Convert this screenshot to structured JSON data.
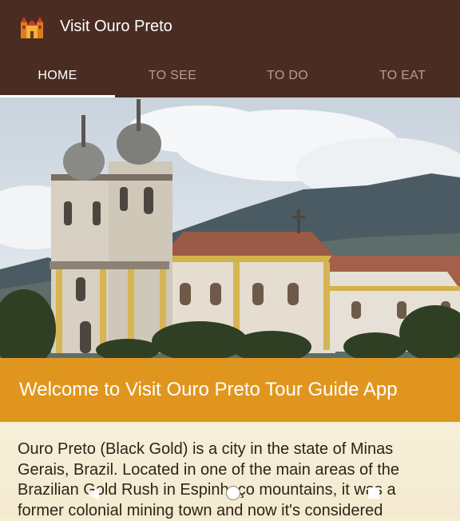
{
  "app": {
    "title": "Visit Ouro Preto"
  },
  "tabs": [
    {
      "label": "HOME"
    },
    {
      "label": "TO SEE"
    },
    {
      "label": "TO DO"
    },
    {
      "label": "TO EAT"
    }
  ],
  "hero": {
    "icon": "church-photo"
  },
  "banner": {
    "title": "Welcome to Visit Ouro Preto Tour Guide App"
  },
  "content": {
    "description": "Ouro Preto (Black Gold) is a city in the state of Minas Gerais, Brazil. Located in one of the main areas of the Brazilian Gold Rush in Espinhaço mountains, it was a former colonial mining town and now it's considered"
  },
  "colors": {
    "appbar": "#4a2c22",
    "banner": "#e0961e",
    "background": "#f6efd8"
  }
}
